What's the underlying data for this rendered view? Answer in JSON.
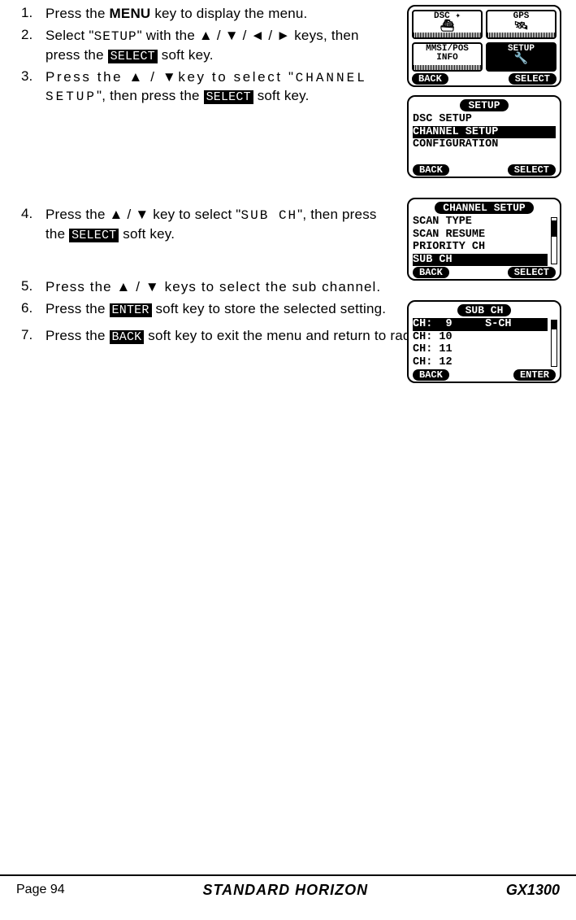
{
  "steps": [
    {
      "num": "1.",
      "parts": {
        "pre": "Press the ",
        "menu": "MENU",
        "post": " key to display the menu."
      }
    },
    {
      "num": "2.",
      "parts": {
        "pre": "Select \"",
        "setup": "SETUP",
        "mid": "\" with the ▲ / ▼ / ◄ / ► keys, then press the ",
        "select": "SELECT",
        "post": " soft key."
      }
    },
    {
      "num": "3.",
      "parts": {
        "pre": "Press the ▲ / ▼key to select \"",
        "ch": "CHANNEL SETUP",
        "mid": "\", then press the ",
        "select": "SELECT",
        "post": " soft key."
      }
    },
    {
      "num": "4.",
      "parts": {
        "pre": "Press the ▲ / ▼ key to select \"",
        "sub": "SUB CH",
        "mid": "\", then press the ",
        "select": "SELECT",
        "post": " soft key."
      }
    },
    {
      "num": "5.",
      "parts": {
        "text": "Press the ▲ / ▼ keys to select the sub channel."
      }
    },
    {
      "num": "6.",
      "parts": {
        "pre": "Press the ",
        "enter": "ENTER",
        "post": " soft key to store the selected setting."
      }
    },
    {
      "num": "7.",
      "parts": {
        "pre": "Press the ",
        "back": "BACK",
        "post": " soft key to exit the menu and return to radio operation."
      }
    }
  ],
  "screen1": {
    "cells": {
      "a": "DSC",
      "b": "GPS",
      "c1": "MMSI/POS",
      "c2": "INFO",
      "d": "SETUP"
    },
    "back": "BACK",
    "select": "SELECT"
  },
  "screen2": {
    "title": "SETUP",
    "l1": "DSC SETUP",
    "l2": "CHANNEL SETUP   ",
    "l3": "CONFIGURATION",
    "back": "BACK",
    "select": "SELECT"
  },
  "screen3": {
    "title": "CHANNEL SETUP",
    "l1": "SCAN TYPE",
    "l2": "SCAN RESUME",
    "l3": "PRIORITY CH",
    "l4": "SUB CH         ",
    "back": "BACK",
    "select": "SELECT"
  },
  "screen4": {
    "title": "SUB CH",
    "l1": "CH:  9     S-CH",
    "l2": "CH: 10",
    "l3": "CH: 11",
    "l4": "CH: 12",
    "back": "BACK",
    "enter": "ENTER"
  },
  "footer": {
    "page": "Page 94",
    "brand": "STANDARD HORIZON",
    "model": "GX1300"
  }
}
